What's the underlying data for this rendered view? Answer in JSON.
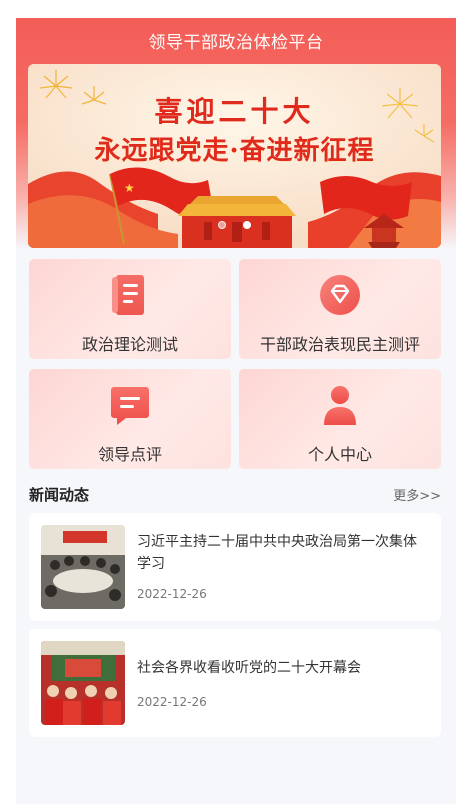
{
  "header": {
    "title": "领导干部政治体检平台"
  },
  "banner": {
    "line1": "喜迎二十大",
    "line2": "永远跟党走·奋进新征程",
    "slides": 2,
    "active_slide": 2
  },
  "menu": [
    {
      "label": "政治理论测试",
      "icon": "scroll-icon"
    },
    {
      "label": "干部政治表现民主测评",
      "icon": "diamond-badge-icon"
    },
    {
      "label": "领导点评",
      "icon": "comment-icon"
    },
    {
      "label": "个人中心",
      "icon": "user-icon"
    }
  ],
  "news": {
    "title": "新闻动态",
    "more": "更多>>",
    "items": [
      {
        "title": "习近平主持二十届中共中央政治局第一次集体学习",
        "date": "2022-12-26"
      },
      {
        "title": "社会各界收看收听党的二十大开幕会",
        "date": "2022-12-26"
      }
    ]
  },
  "colors": {
    "accent": "#f35d57",
    "icon": "#f0625c",
    "card_bg": "#fde0dc"
  }
}
